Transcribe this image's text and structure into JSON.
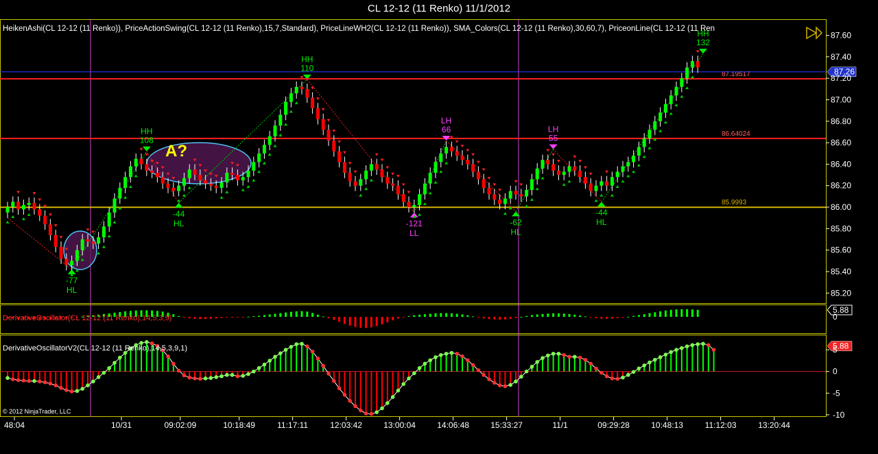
{
  "window": {
    "title": "CL 12-12 (11 Renko)  11/1/2012"
  },
  "colors": {
    "background": "#000000",
    "up": "#00ff00",
    "down": "#ff0000",
    "grid": "#c8c800",
    "price_badge": "#2233cc",
    "osc_badge": "#ee2222",
    "session": "#cc44cc"
  },
  "indicators_label": "HeikenAshi(CL 12-12 (11 Renko)), PriceActionSwing(CL 12-12 (11 Renko),15,7,Standard), PriceLineWH2(CL 12-12 (11 Renko)), SMA_Colors(CL 12-12 (11 Renko),30,60,7), PriceonLine(CL 12-12 (11 Ren",
  "osc1_label": "DerivativeOscillator(CL 12-12 (11 Renko),14,5,3,9)",
  "osc2_label": "DerivativeOscillatorV2(CL 12-12 (11 Renko),14,5,3,9,1)",
  "copyright": "© 2012 NinjaTrader, LLC",
  "annotation": "A?",
  "chart_data": {
    "type": "candlestick",
    "price_axis": {
      "ticks": [
        "87.60",
        "87.40",
        "87.20",
        "87.00",
        "86.80",
        "86.60",
        "86.40",
        "86.20",
        "86.00",
        "85.80",
        "85.60",
        "85.40",
        "85.20"
      ],
      "range": [
        85.1,
        87.75
      ]
    },
    "time_axis": {
      "ticks": [
        "48:04",
        "10/31",
        "09:02:09",
        "10:18:49",
        "11:17:11",
        "12:03:42",
        "13:00:04",
        "14:06:48",
        "15:33:27",
        "11/1",
        "09:29:28",
        "10:48:13",
        "11:12:03",
        "13:20:44"
      ],
      "ticks_bar_index": [
        0,
        20,
        31,
        42,
        52,
        62,
        72,
        82,
        92,
        102,
        112,
        122,
        132,
        142
      ]
    },
    "current_price": "87.26",
    "levels": [
      {
        "label": "87.19517",
        "value": 87.195,
        "color": "#ff2020"
      },
      {
        "label": "86.64024",
        "value": 86.64,
        "color": "#ff2020"
      },
      {
        "label": "85.9993",
        "value": 85.999,
        "color": "#d4b400"
      }
    ],
    "swings": [
      {
        "i": 12,
        "price": 85.42,
        "num": "-77",
        "tag": "HL",
        "pos": "below",
        "kind": "up"
      },
      {
        "i": 26,
        "price": 86.52,
        "num": "108",
        "tag": "HH",
        "pos": "above",
        "kind": "up"
      },
      {
        "i": 32,
        "price": 86.04,
        "num": "-44",
        "tag": "HL",
        "pos": "below",
        "kind": "up"
      },
      {
        "i": 56,
        "price": 87.19,
        "num": "110",
        "tag": "HH",
        "pos": "above",
        "kind": "up"
      },
      {
        "i": 76,
        "price": 85.95,
        "num": "-121",
        "tag": "LL",
        "pos": "below",
        "kind": "down"
      },
      {
        "i": 82,
        "price": 86.62,
        "num": "66",
        "tag": "LH",
        "pos": "above",
        "kind": "down"
      },
      {
        "i": 95,
        "price": 85.96,
        "num": "-62",
        "tag": "HL",
        "pos": "below",
        "kind": "up"
      },
      {
        "i": 102,
        "price": 86.54,
        "num": "55",
        "tag": "LH",
        "pos": "above",
        "kind": "down"
      },
      {
        "i": 111,
        "price": 86.05,
        "num": "-44",
        "tag": "HL",
        "pos": "below",
        "kind": "up"
      },
      {
        "i": 130,
        "price": 87.43,
        "num": "132",
        "tag": "HH",
        "pos": "above",
        "kind": "up"
      }
    ],
    "closes": [
      86.0,
      86.05,
      85.98,
      86.02,
      86.04,
      85.98,
      85.92,
      85.84,
      85.74,
      85.63,
      85.52,
      85.46,
      85.5,
      85.6,
      85.7,
      85.68,
      85.66,
      85.72,
      85.82,
      85.95,
      86.08,
      86.18,
      86.28,
      86.38,
      86.45,
      86.4,
      86.34,
      86.32,
      86.28,
      86.22,
      86.18,
      86.15,
      86.2,
      86.27,
      86.35,
      86.3,
      86.25,
      86.22,
      86.2,
      86.18,
      86.23,
      86.32,
      86.3,
      86.25,
      86.28,
      86.34,
      86.42,
      86.5,
      86.58,
      86.66,
      86.76,
      86.86,
      86.98,
      87.06,
      87.12,
      87.1,
      87.02,
      86.92,
      86.82,
      86.72,
      86.62,
      86.52,
      86.42,
      86.32,
      86.24,
      86.2,
      86.26,
      86.34,
      86.4,
      86.35,
      86.28,
      86.22,
      86.2,
      86.12,
      86.05,
      86.0,
      86.02,
      86.12,
      86.22,
      86.32,
      86.42,
      86.5,
      86.56,
      86.52,
      86.48,
      86.44,
      86.4,
      86.33,
      86.26,
      86.18,
      86.12,
      86.07,
      86.03,
      86.08,
      86.15,
      86.12,
      86.1,
      86.16,
      86.26,
      86.36,
      86.44,
      86.4,
      86.34,
      86.3,
      86.33,
      86.38,
      86.34,
      86.28,
      86.22,
      86.15,
      86.2,
      86.24,
      86.2,
      86.28,
      86.33,
      86.38,
      86.42,
      86.48,
      86.56,
      86.64,
      86.72,
      86.8,
      86.88,
      86.96,
      87.04,
      87.12,
      87.2,
      87.3,
      87.36,
      87.3
    ],
    "osc1": {
      "label": "5.88",
      "hist": [
        -0.6,
        -0.7,
        -0.8,
        -0.9,
        -1.0,
        -1.0,
        -1.1,
        -1.1,
        -1.1,
        -1.0,
        -0.9,
        -0.7,
        -0.5,
        -0.2,
        0.1,
        0.4,
        0.7,
        1.0,
        1.3,
        1.6,
        1.9,
        2.2,
        2.5,
        2.7,
        2.9,
        3.0,
        3.0,
        2.9,
        2.7,
        2.4,
        1.9,
        1.2,
        0.4,
        -0.3,
        -0.7,
        -0.9,
        -1.0,
        -1.0,
        -0.9,
        -0.7,
        -0.5,
        -0.3,
        -0.2,
        -0.2,
        -0.1,
        0.1,
        0.3,
        0.5,
        0.8,
        1.1,
        1.4,
        1.7,
        2.0,
        2.3,
        2.5,
        2.6,
        2.4,
        1.8,
        1.0,
        0.2,
        -0.6,
        -1.4,
        -2.3,
        -3.2,
        -4.0,
        -4.6,
        -5.0,
        -5.1,
        -4.8,
        -4.2,
        -3.4,
        -2.5,
        -1.6,
        -0.8,
        -0.2,
        0.3,
        0.7,
        1.0,
        1.2,
        1.4,
        1.6,
        1.7,
        1.7,
        1.6,
        1.4,
        1.1,
        0.7,
        0.2,
        -0.3,
        -0.7,
        -1.0,
        -1.2,
        -1.3,
        -1.2,
        -0.9,
        -0.5,
        0.0,
        0.4,
        0.8,
        1.1,
        1.3,
        1.5,
        1.6,
        1.6,
        1.5,
        1.3,
        1.0,
        0.6,
        0.2,
        -0.2,
        -0.6,
        -0.8,
        -0.9,
        -0.8,
        -0.6,
        -0.3,
        0.0,
        0.4,
        0.8,
        1.2,
        1.7,
        2.1,
        2.5,
        2.9,
        3.2,
        3.4,
        3.5,
        3.5,
        3.4,
        3.2
      ]
    },
    "osc2": {
      "label": "5.88",
      "ticks": [
        "5",
        "0",
        "-5",
        "-10"
      ],
      "range": [
        -10.5,
        8.5
      ],
      "values": [
        -1.5,
        -1.8,
        -2.0,
        -2.1,
        -2.2,
        -2.2,
        -2.3,
        -2.5,
        -2.8,
        -3.2,
        -3.8,
        -4.3,
        -4.6,
        -4.5,
        -4.0,
        -3.2,
        -2.3,
        -1.3,
        -0.3,
        0.8,
        2.0,
        3.2,
        4.3,
        5.3,
        6.1,
        6.6,
        6.8,
        6.5,
        5.9,
        4.9,
        3.5,
        1.8,
        0.2,
        -0.9,
        -1.4,
        -1.6,
        -1.7,
        -1.6,
        -1.5,
        -1.3,
        -1.1,
        -0.8,
        -0.8,
        -1.1,
        -1.0,
        -0.6,
        0.0,
        0.8,
        1.6,
        2.5,
        3.4,
        4.2,
        5.0,
        5.7,
        6.3,
        6.4,
        5.8,
        4.6,
        3.0,
        1.3,
        -0.5,
        -2.2,
        -3.9,
        -5.4,
        -6.8,
        -8.0,
        -9.0,
        -9.7,
        -9.8,
        -9.4,
        -8.5,
        -7.3,
        -5.9,
        -4.4,
        -2.9,
        -1.6,
        -0.4,
        0.8,
        1.8,
        2.6,
        3.3,
        3.8,
        4.1,
        4.3,
        4.1,
        3.5,
        2.6,
        1.5,
        0.3,
        -0.8,
        -1.8,
        -2.6,
        -3.2,
        -3.4,
        -3.1,
        -2.3,
        -1.2,
        0.0,
        1.1,
        2.2,
        3.1,
        3.7,
        4.1,
        4.1,
        3.8,
        3.4,
        3.4,
        3.2,
        2.7,
        1.8,
        0.7,
        -0.3,
        -1.1,
        -1.6,
        -1.7,
        -1.4,
        -0.8,
        -0.1,
        0.7,
        1.4,
        2.1,
        2.7,
        3.3,
        3.9,
        4.5,
        5.0,
        5.4,
        5.8,
        6.1,
        6.3,
        6.4,
        6.1,
        5.0
      ]
    }
  }
}
